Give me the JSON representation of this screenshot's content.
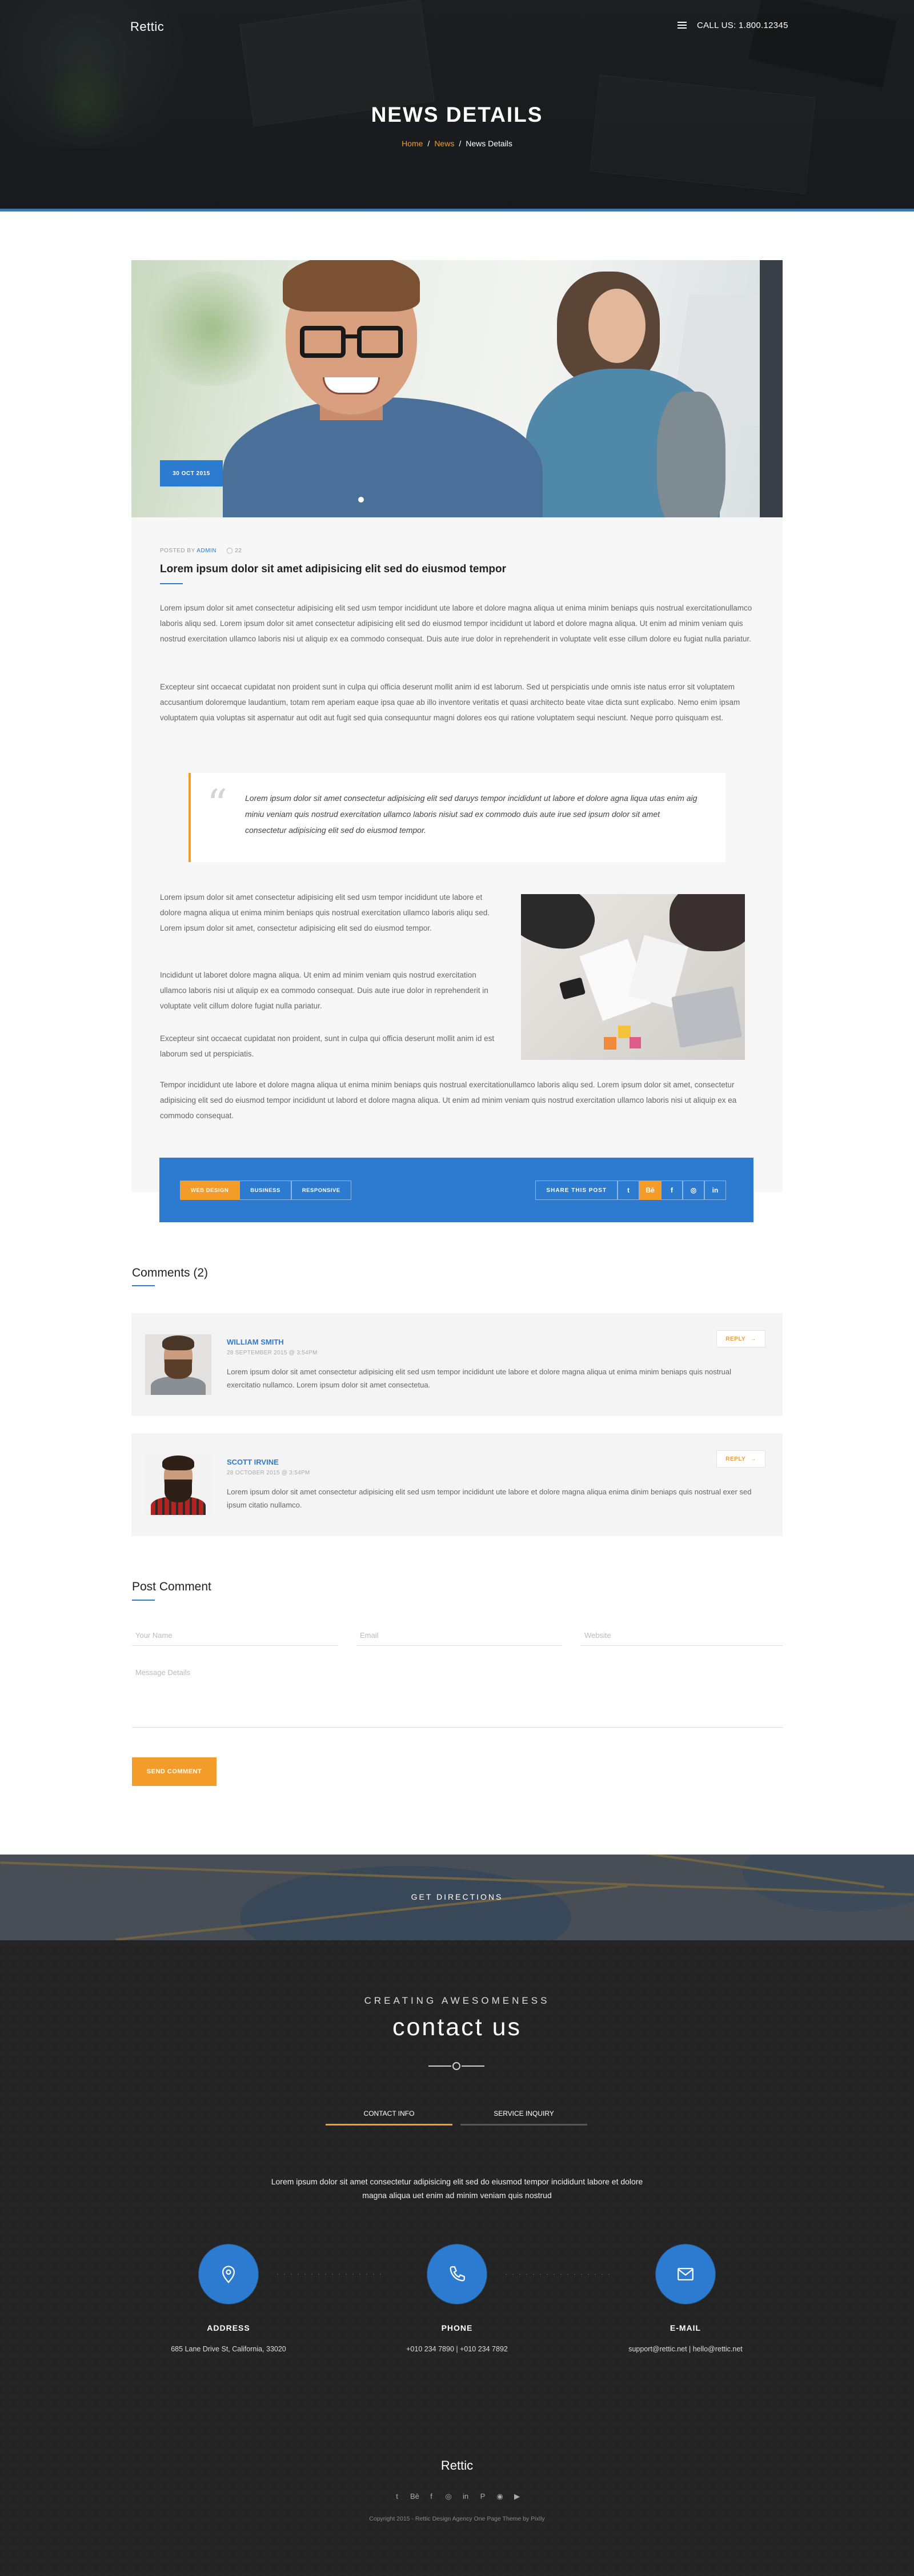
{
  "header": {
    "logo": "Rettic",
    "call": "CALL US: 1.800.12345",
    "title": "NEWS DETAILS",
    "breadcrumb": [
      "Home",
      "News",
      "News Details"
    ],
    "breadcrumb_sep": "/"
  },
  "article": {
    "date_badge": "30 OCT 2015",
    "meta_posted": "POSTED BY",
    "meta_author": "ADMIN",
    "meta_comments": "22",
    "title": "Lorem ipsum dolor sit amet adipisicing elit sed do eiusmod tempor",
    "p1": "Lorem ipsum dolor sit amet consectetur adipisicing elit sed usm tempor incididunt ute labore et dolore magna aliqua ut enima minim beniaps quis nostrual exercitationullamco laboris aliqu sed.  Lorem ipsum dolor sit amet consectetur adipisicing elit sed do eiusmod tempor incididunt ut labord et dolore magna aliqua. Ut enim ad minim veniam quis nostrud exercitation ullamco laboris nisi ut aliquip ex ea commodo consequat. Duis aute irue dolor in reprehenderit in voluptate velit esse cillum dolore eu fugiat nulla pariatur.",
    "p2": "Excepteur sint occaecat cupidatat non proident sunt in culpa qui officia deserunt mollit anim id est laborum. Sed ut perspiciatis unde omnis iste natus error sit voluptatem accusantium doloremque laudantium, totam rem aperiam eaque ipsa quae ab illo inventore veritatis et quasi architecto beate vitae dicta sunt explicabo. Nemo enim ipsam voluptatem quia voluptas sit aspernatur aut odit aut fugit sed quia consequuntur magni dolores eos qui ratione voluptatem sequi nesciunt. Neque porro quisquam est.",
    "quote": "Lorem ipsum dolor sit amet consectetur adipisicing elit sed daruys tempor incididunt ut labore et dolore agna liqua utas enim aig miniu veniam quis nostrud exercitation ullamco laboris nisiut sad ex commodo duis aute irue sed ipsum dolor sit amet consectetur adipisicing elit sed do eiusmod tempor.",
    "p3": "Lorem ipsum dolor sit amet consectetur adipisicing elit sed usm tempor incididunt ute labore et dolore magna aliqua ut enima minim beniaps quis nostrual exercitation ullamco laboris aliqu sed.  Lorem ipsum dolor sit amet, consectetur adipisicing elit sed do eiusmod tempor.",
    "p4": "Incididunt ut laboret dolore magna aliqua. Ut enim ad minim veniam quis nostrud exercitation ullamco laboris nisi ut aliquip ex ea commodo consequat. Duis aute irue dolor in reprehenderit in voluptate velit cillum dolore fugiat nulla pariatur.",
    "p5": "Excepteur sint occaecat cupidatat non proident, sunt in culpa qui officia deserunt mollit anim id est laborum sed ut perspiciatis.",
    "p6": "Tempor incididunt ute labore et dolore magna aliqua ut enima minim beniaps quis nostrual exercitationullamco laboris aliqu sed.  Lorem ipsum dolor sit amet, consectetur adipisicing elit sed do eiusmod tempor incididunt ut labord et dolore magna aliqua. Ut enim ad minim veniam quis nostrud exercitation ullamco laboris nisi ut aliquip ex ea commodo consequat.",
    "tags": [
      "WEB DESIGN",
      "BUSINESS",
      "RESPONSIVE"
    ],
    "share_label": "SHARE THIS POST",
    "share_icons": [
      "twitter-icon",
      "behance-icon",
      "facebook-icon",
      "instagram-icon",
      "linkedin-icon"
    ],
    "share_glyphs": [
      "t",
      "Bē",
      "f",
      "◎",
      "in"
    ]
  },
  "comments": {
    "title": "Comments (2)",
    "reply_label": "REPLY",
    "items": [
      {
        "name": "WILLIAM SMITH",
        "date": "28 SEPTEMBER 2015  @  3:54PM",
        "text": "Lorem ipsum dolor sit amet consectetur adipisicing elit sed usm tempor incididunt ute labore et dolore magna aliqua ut enima minim beniaps quis nostrual exercitatio nullamco. Lorem ipsum dolor sit amet consectetua."
      },
      {
        "name": "SCOTT IRVINE",
        "date": "28 OCTOBER 2015  @  3:54PM",
        "text": "Lorem ipsum dolor sit amet consectetur adipisicing elit sed usm tempor incididunt ute labore et dolore magna aliqua enima dinim beniaps quis nostrual exer sed ipsum citatio nullamco."
      }
    ]
  },
  "form": {
    "title": "Post Comment",
    "name_placeholder": "Your Name",
    "email_placeholder": "Email",
    "website_placeholder": "Website",
    "message_placeholder": "Message Details",
    "submit": "SEND COMMENT"
  },
  "map": {
    "label": "GET DIRECTIONS"
  },
  "contact": {
    "kicker": "CREATING AWESOMENESS",
    "heading": "contact us",
    "tabs": [
      "CONTACT INFO",
      "SERVICE INQUIRY"
    ],
    "description": "Lorem ipsum dolor sit amet consectetur adipisicing elit sed do eiusmod tempor incididunt labore et dolore magna aliqua uet enim ad minim veniam quis nostrud",
    "blocks": [
      {
        "label": "ADDRESS",
        "value": "685 Lane Drive St, California, 33020",
        "icon": "location-pin-icon"
      },
      {
        "label": "PHONE",
        "value": "+010 234 7890  |  +010 234 7892",
        "icon": "phone-icon"
      },
      {
        "label": "E-MAIL",
        "value": "support@rettic.net  |  hello@rettic.net",
        "icon": "envelope-icon"
      }
    ],
    "accent": "#2c7bd1"
  },
  "footer": {
    "logo": "Rettic",
    "social_icons": [
      "twitter-icon",
      "behance-icon",
      "facebook-icon",
      "instagram-icon",
      "linkedin-icon",
      "pinterest-icon",
      "dribbble-icon",
      "youtube-icon"
    ],
    "social_glyphs": [
      "t",
      "Bē",
      "f",
      "◎",
      "in",
      "P",
      "◉",
      "▶"
    ],
    "copyright": "Copyright 2015 - Rettic Design Agency One Page Theme by Pixlly"
  },
  "colors": {
    "primary_blue": "#2c7bd1",
    "accent_orange": "#f39c2a",
    "dark_bg": "#242424"
  }
}
